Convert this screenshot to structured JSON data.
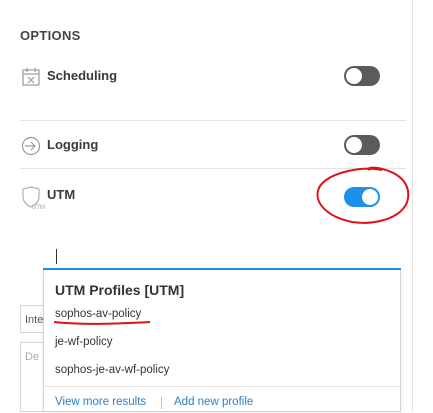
{
  "options": {
    "title": "OPTIONS",
    "rows": [
      {
        "label": "Scheduling",
        "icon": "calendar-x-icon",
        "enabled": false
      },
      {
        "label": "Logging",
        "icon": "arrow-circle-icon",
        "enabled": false
      },
      {
        "label": "UTM",
        "icon": "shield-utm-icon",
        "icon_caption": "UTM",
        "enabled": true
      }
    ]
  },
  "search": {
    "value": ""
  },
  "background_fields": {
    "select_text": "Inte",
    "textarea_placeholder": "De"
  },
  "dropdown": {
    "header": "UTM Profiles [UTM]",
    "items": [
      "sophos-av-policy",
      "je-wf-policy",
      "sophos-je-av-wf-policy"
    ],
    "footer": {
      "view_more": "View more results",
      "add_new": "Add new profile"
    }
  },
  "colors": {
    "toggle_on": "#1e90e8",
    "toggle_off": "#5b5b5b",
    "link": "#2b7fc4",
    "annotation": "#e0101a"
  }
}
